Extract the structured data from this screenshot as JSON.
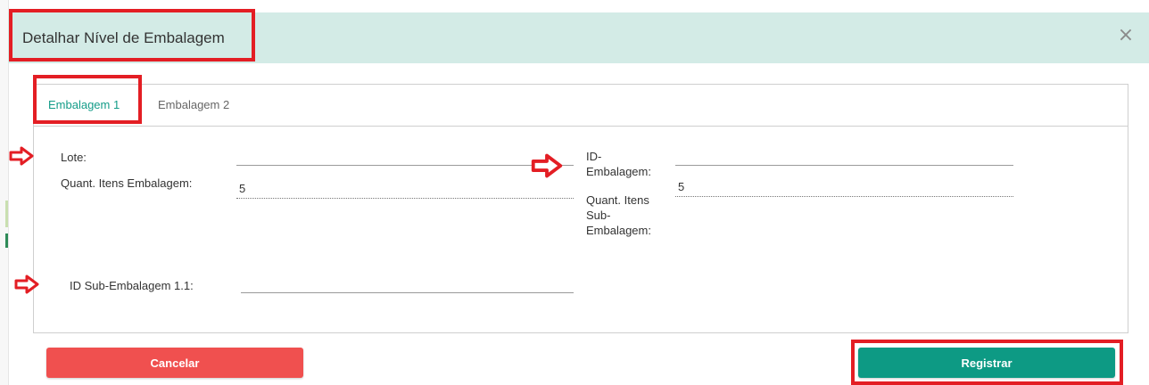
{
  "modal": {
    "title": "Detalhar Nível de Embalagem",
    "close_symbol": "×",
    "close_icon": "close-icon"
  },
  "tabs": [
    {
      "label": "Embalagem 1",
      "active": true
    },
    {
      "label": "Embalagem 2",
      "active": false
    }
  ],
  "form": {
    "lote": {
      "label": "Lote:",
      "value": ""
    },
    "quant_itens": {
      "label": "Quant. Itens Embalagem:",
      "value": "5"
    },
    "id_embalagem": {
      "label_line1": "ID-",
      "label_line2": "Embalagem:",
      "value": ""
    },
    "quant_itens_sub": {
      "label_line1": "Quant. Itens",
      "label_line2": "Sub-",
      "label_line3": "Embalagem:",
      "value": "5"
    },
    "id_sub_embalagem": {
      "label": "ID Sub-Embalagem 1.1:",
      "value": ""
    }
  },
  "buttons": {
    "cancel_label": "Cancelar",
    "register_label": "Registrar"
  },
  "colors": {
    "header_bg": "#d3ebe6",
    "accent_teal": "#139c88",
    "cancel_red": "#f0504f",
    "register_green": "#0d9a84",
    "annotation_red": "#e31e24"
  }
}
